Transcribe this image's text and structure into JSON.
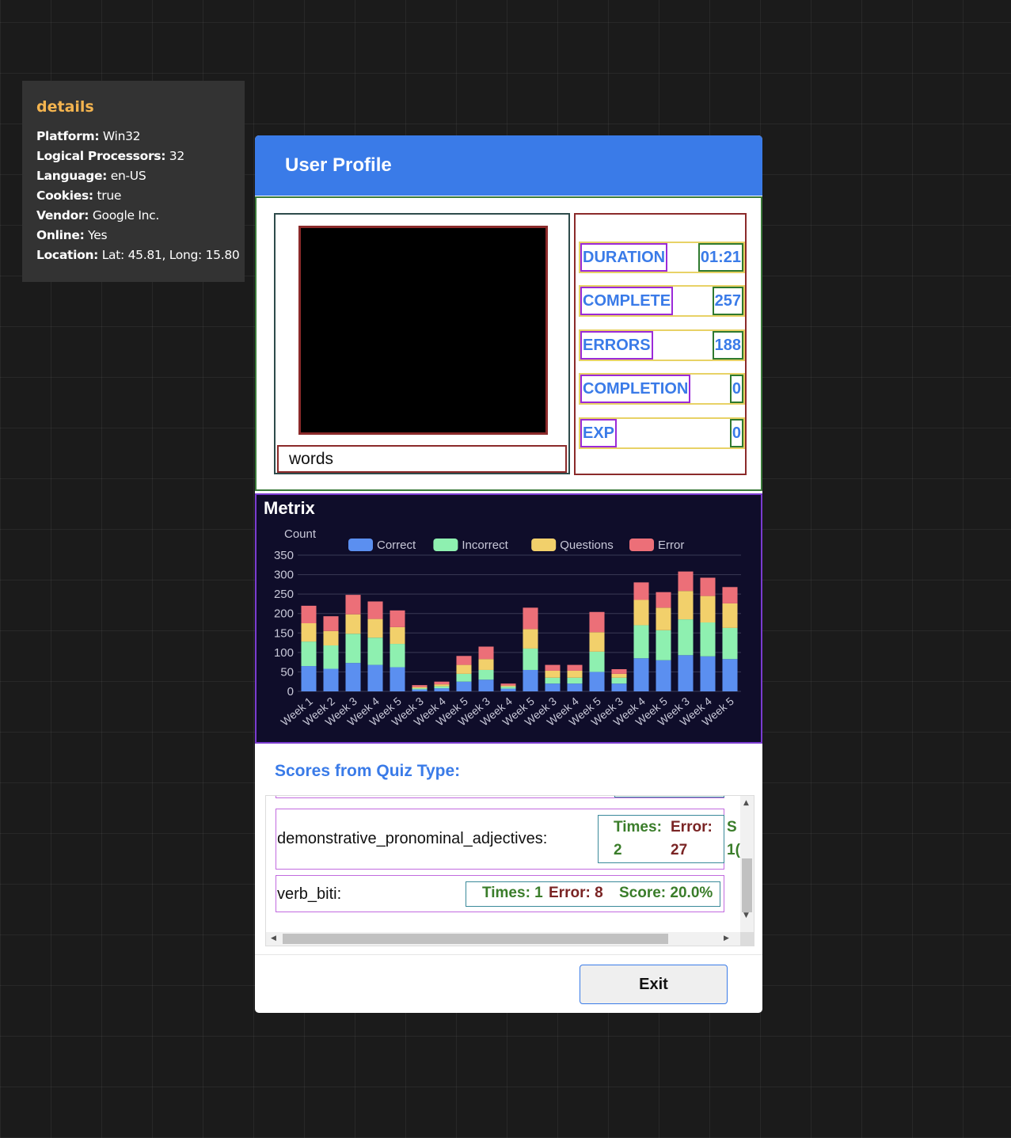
{
  "details": {
    "title": "details",
    "rows": [
      {
        "key": "Platform:",
        "value": "Win32"
      },
      {
        "key": "Logical Processors:",
        "value": "32"
      },
      {
        "key": "Language:",
        "value": "en-US"
      },
      {
        "key": "Cookies:",
        "value": "true"
      },
      {
        "key": "Vendor:",
        "value": "Google Inc."
      },
      {
        "key": "Online:",
        "value": "Yes"
      },
      {
        "key": "Location:",
        "value": "Lat: 45.81, Long: 15.80"
      }
    ]
  },
  "dialog": {
    "title": "User Profile",
    "username": "words",
    "stats": [
      {
        "label": "DURATION",
        "value": "01:21"
      },
      {
        "label": "COMPLETE",
        "value": "257"
      },
      {
        "label": "ERRORS",
        "value": "188"
      },
      {
        "label": "COMPLETION",
        "value": "0"
      },
      {
        "label": "EXP",
        "value": "0"
      }
    ],
    "scores_title": "Scores from Quiz Type:",
    "quiz_rows": [
      {
        "name": "demonstrative_pronominal_adjectives:",
        "times_label": "Times:",
        "times_value": "2",
        "error_label": "Error:",
        "error_value": "27",
        "score_partial": "S",
        "score_partial2": "1("
      },
      {
        "name": "verb_biti:",
        "times": "Times: 1",
        "error": "Error: 8",
        "score": "Score: 20.0%"
      }
    ],
    "exit_label": "Exit"
  },
  "chart_data": {
    "type": "bar",
    "stacked": true,
    "title": "Metrix",
    "ylabel": "Count",
    "xlabel": "",
    "ylim": [
      0,
      350
    ],
    "yticks": [
      0,
      50,
      100,
      150,
      200,
      250,
      300,
      350
    ],
    "categories": [
      "Week 1",
      "Week 2",
      "Week 3",
      "Week 4",
      "Week 5",
      "Week 3",
      "Week 4",
      "Week 5",
      "Week 3",
      "Week 4",
      "Week 5",
      "Week 3",
      "Week 4",
      "Week 5",
      "Week 3",
      "Week 4",
      "Week 5",
      "Week 3",
      "Week 4",
      "Week 5"
    ],
    "series": [
      {
        "name": "Correct",
        "color": "#5b8ff0",
        "values": [
          65,
          58,
          73,
          68,
          62,
          5,
          8,
          25,
          30,
          7,
          55,
          20,
          20,
          50,
          20,
          85,
          80,
          93,
          90,
          83
        ]
      },
      {
        "name": "Incorrect",
        "color": "#8ef0b0",
        "values": [
          63,
          60,
          75,
          70,
          60,
          3,
          5,
          20,
          25,
          5,
          55,
          15,
          15,
          52,
          15,
          85,
          77,
          92,
          87,
          80
        ]
      },
      {
        "name": "Questions",
        "color": "#f2d06b",
        "values": [
          47,
          37,
          50,
          48,
          43,
          3,
          5,
          23,
          28,
          3,
          50,
          18,
          18,
          50,
          10,
          65,
          58,
          73,
          68,
          63
        ]
      },
      {
        "name": "Error",
        "color": "#ec6f78",
        "values": [
          45,
          38,
          50,
          45,
          43,
          5,
          7,
          23,
          32,
          5,
          55,
          15,
          15,
          52,
          12,
          45,
          40,
          50,
          47,
          42
        ]
      }
    ],
    "grid": true,
    "legend": "top"
  }
}
